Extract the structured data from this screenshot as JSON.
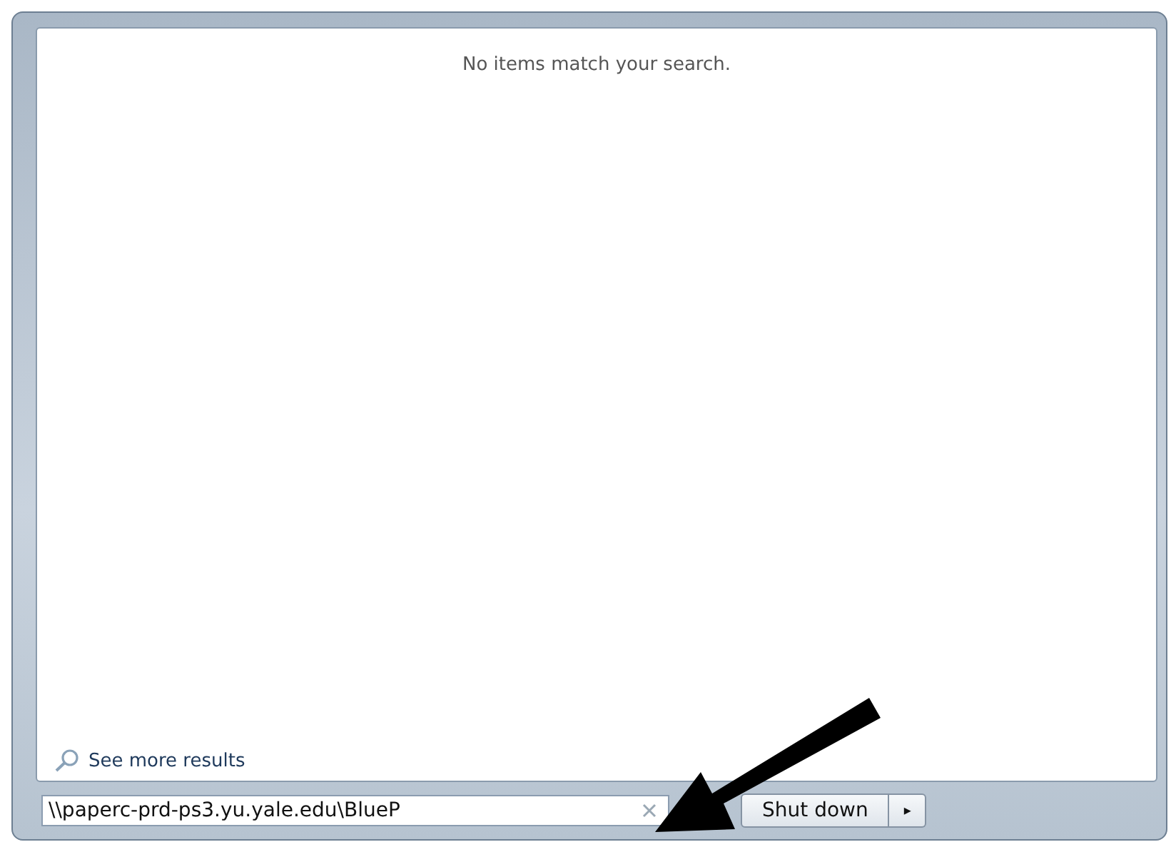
{
  "results": {
    "message": "No items match your search.",
    "see_more": "See more results"
  },
  "search": {
    "value": "\\\\paperc-prd-ps3.yu.yale.edu\\BlueP"
  },
  "shutdown": {
    "label": "Shut down",
    "menu_glyph": "▸"
  }
}
